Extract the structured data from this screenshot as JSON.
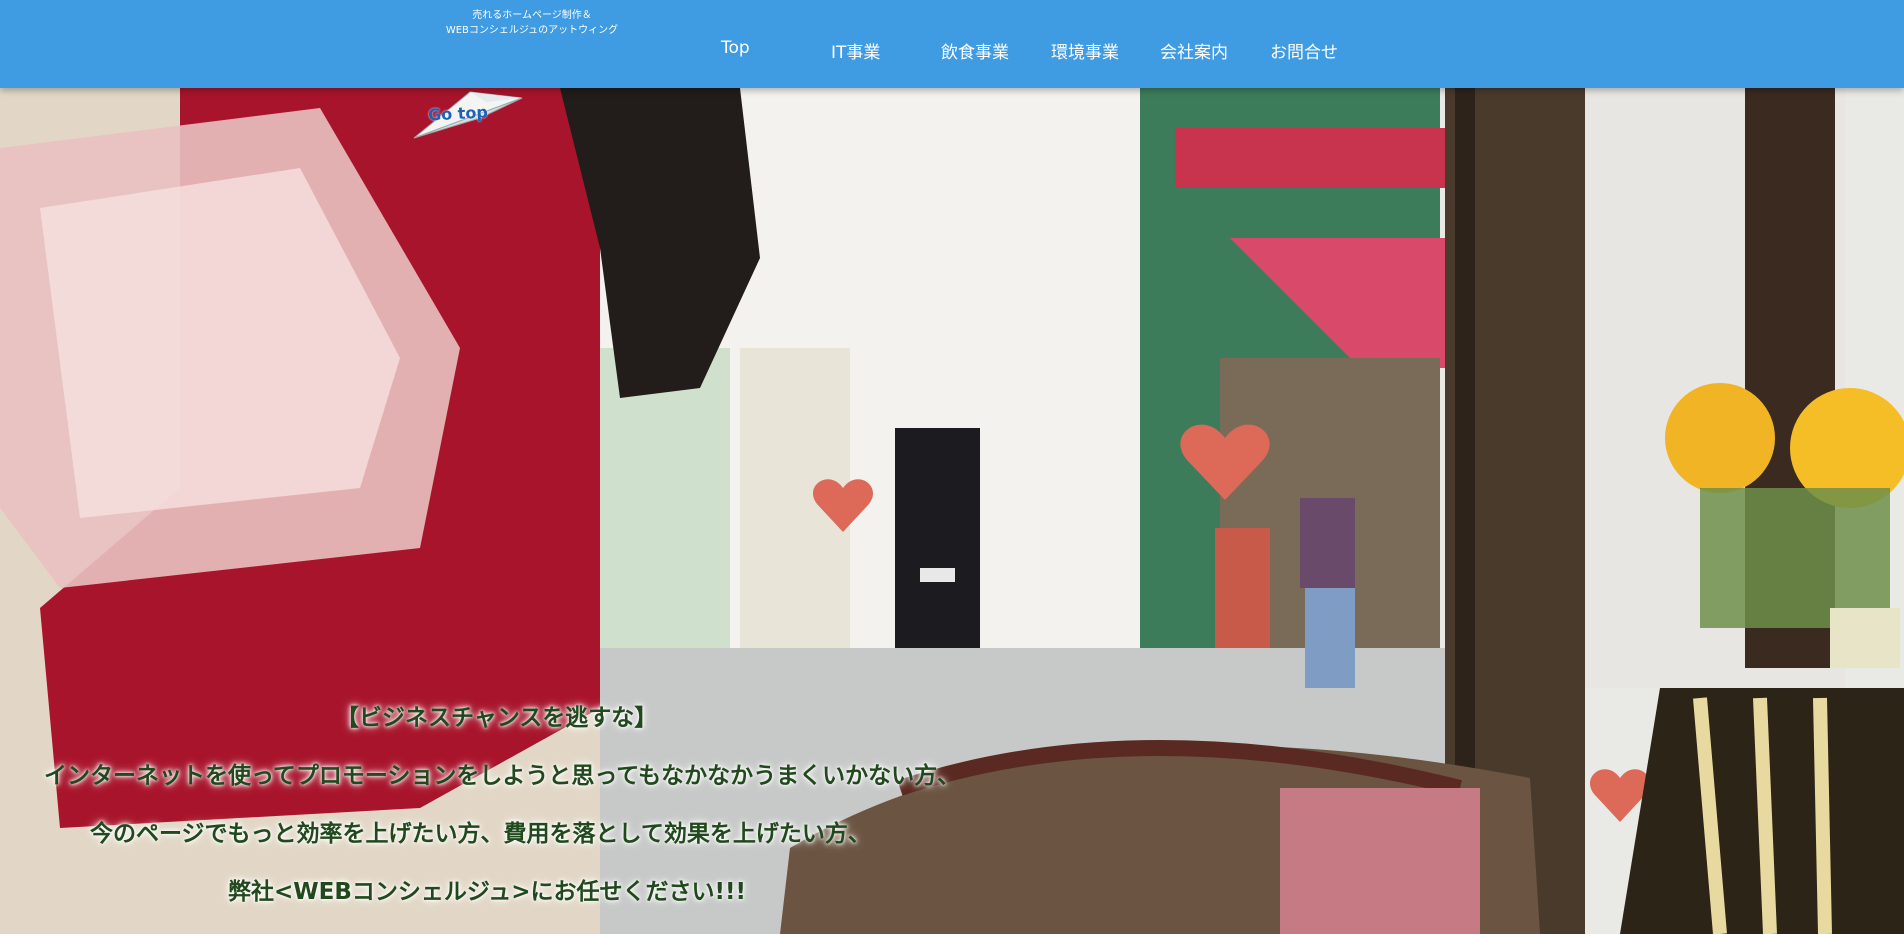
{
  "header": {
    "tagline_line1": "売れるホームページ制作＆",
    "tagline_line2": "WEBコンシェルジュのアットウィング"
  },
  "nav": {
    "items": [
      {
        "label": "Top"
      },
      {
        "label": "IT事業"
      },
      {
        "label": "飲食事業"
      },
      {
        "label": "環境事業"
      },
      {
        "label": "会社案内"
      },
      {
        "label": "お問合せ"
      }
    ]
  },
  "go_top": {
    "label": "Go top"
  },
  "hero": {
    "headline": "【ビジネスチャンスを逃すな】",
    "lines": [
      "インターネットを使ってプロモーションをしようと思ってもなかなかうまくいかない方、",
      "今のページでもっと効率を上げたい方、費用を落として効果を上げたい方、",
      "弊社<WEBコンシェルジュ>にお任せください!!!"
    ]
  },
  "colors": {
    "header_bg": "#3f9be2",
    "catch_text": "#21491d"
  }
}
